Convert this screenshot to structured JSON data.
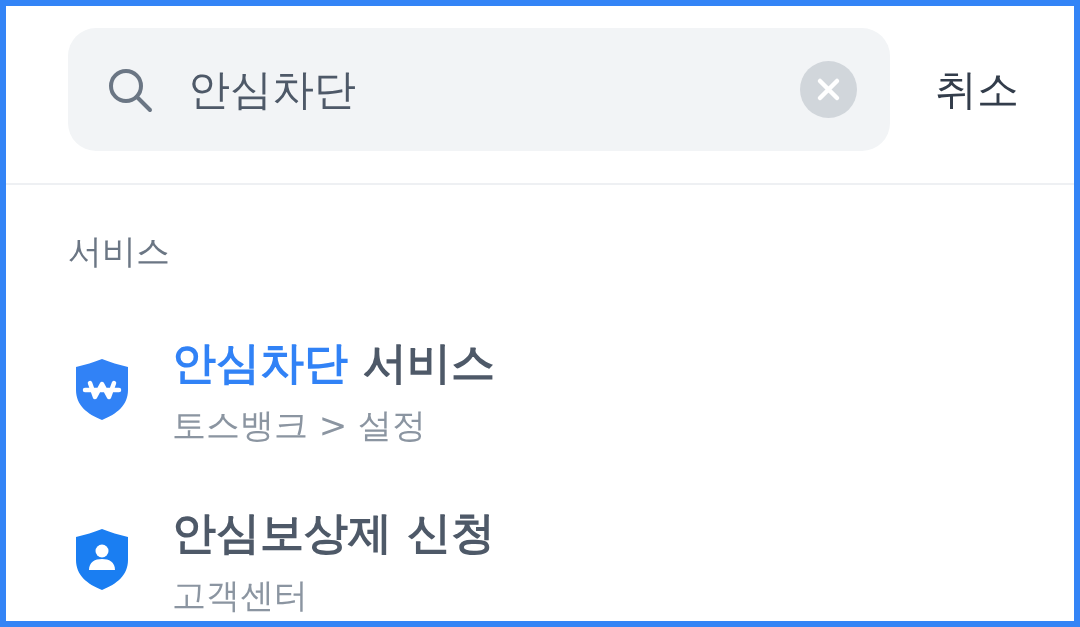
{
  "search": {
    "value": "안심차단"
  },
  "cancel_button": {
    "label": "취소"
  },
  "section": {
    "title": "서비스",
    "results": [
      {
        "title_parts": [
          {
            "text": "안심차단",
            "highlighted": true
          },
          {
            "text": "서비스",
            "highlighted": false
          }
        ],
        "path": "토스뱅크 > 설정"
      },
      {
        "title_parts": [
          {
            "text": "안심보상제 신청",
            "highlighted": false
          }
        ],
        "path": "고객센터"
      }
    ]
  }
}
